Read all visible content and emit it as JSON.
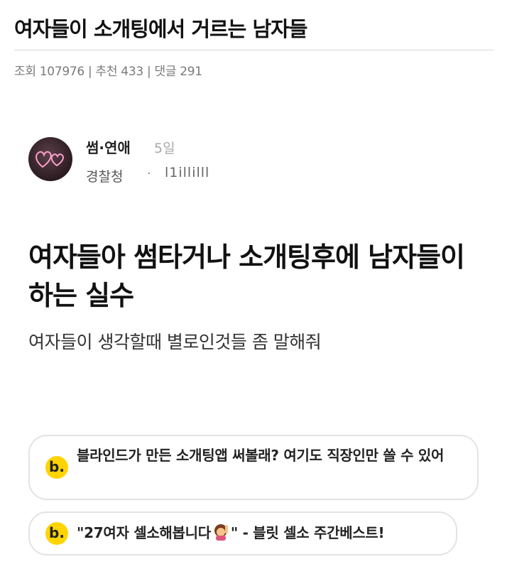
{
  "page": {
    "title": "여자들이 소개팅에서 거르는 남자들",
    "stats": "조회 107976 | 추천 433 | 댓글 291"
  },
  "post": {
    "channel": "썸·연애",
    "time_ago": "5일",
    "company": "경찰청",
    "separator": "·",
    "nickname": "l1illilll",
    "heading": "여자들아 썸타거나 소개팅후에 남자들이 하는 실수",
    "body": "여자들이 생각할때 별로인것들 좀 말해줘"
  },
  "promos": [
    {
      "logo": "b.",
      "text": "블라인드가 만든 소개팅앱 써볼래? 여기도 직장인만 쓸 수 있어"
    },
    {
      "logo": "b.",
      "text_before": "\"27여자 셀소해봅니다",
      "text_after": "\" - 블릿 셀소 주간베스트!",
      "emoji": "woman-raising-hand-icon"
    }
  ],
  "colors": {
    "brand_yellow": "#ffd400",
    "muted_text": "#7a7a7a",
    "border": "#e3e3e3"
  }
}
